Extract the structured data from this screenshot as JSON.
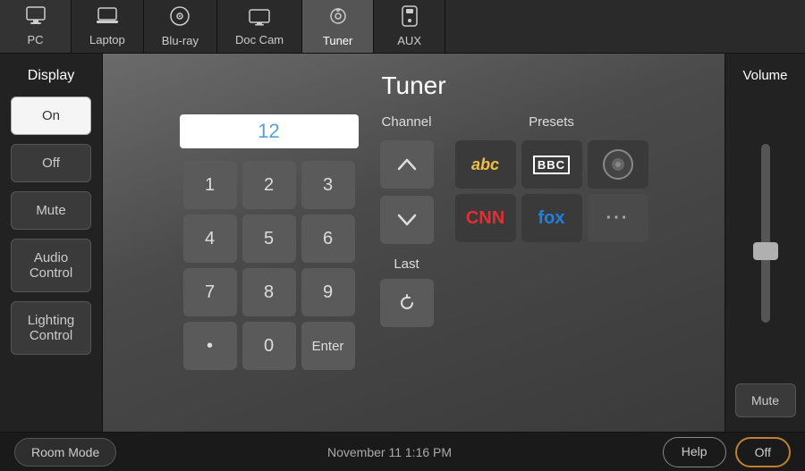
{
  "nav": {
    "items": [
      {
        "id": "pc",
        "label": "PC",
        "icon": "🖥"
      },
      {
        "id": "laptop",
        "label": "Laptop",
        "icon": "💻"
      },
      {
        "id": "bluray",
        "label": "Blu-ray",
        "icon": "💿"
      },
      {
        "id": "doccam",
        "label": "Doc Cam",
        "icon": "🖥"
      },
      {
        "id": "tuner",
        "label": "Tuner",
        "icon": "📡",
        "active": true
      },
      {
        "id": "aux",
        "label": "AUX",
        "icon": "📱"
      }
    ]
  },
  "sidebar": {
    "title": "Display",
    "buttons": [
      {
        "id": "on",
        "label": "On",
        "active": true
      },
      {
        "id": "off",
        "label": "Off",
        "active": false
      },
      {
        "id": "mute",
        "label": "Mute",
        "active": false
      },
      {
        "id": "audio-control",
        "label": "Audio Control",
        "active": false
      },
      {
        "id": "lighting-control",
        "label": "Lighting Control",
        "active": false
      }
    ]
  },
  "panel": {
    "title": "Tuner",
    "channel_display": "12",
    "numpad": [
      "1",
      "2",
      "3",
      "4",
      "5",
      "6",
      "7",
      "8",
      "9",
      "•",
      "0",
      "Enter"
    ],
    "channel": {
      "label": "Channel",
      "up": "∧",
      "down": "∨"
    },
    "last_label": "Last",
    "presets": {
      "label": "Presets",
      "items": [
        {
          "id": "abc",
          "type": "abc"
        },
        {
          "id": "bbc",
          "type": "bbc"
        },
        {
          "id": "cbs",
          "type": "cbs"
        },
        {
          "id": "cnn",
          "type": "cnn"
        },
        {
          "id": "fox",
          "type": "fox"
        },
        {
          "id": "more",
          "type": "more",
          "label": "···"
        }
      ]
    }
  },
  "volume": {
    "title": "Volume",
    "mute_label": "Mute"
  },
  "bottom": {
    "room_mode": "Room Mode",
    "datetime": "November 11 1:16 PM",
    "help": "Help",
    "off": "Off"
  }
}
